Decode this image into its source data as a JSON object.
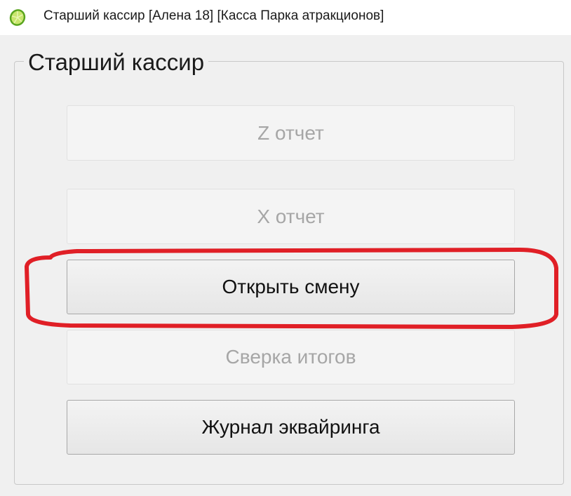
{
  "window": {
    "title": "Старший кассир [Алена 18] [Касса Парка атракционов]",
    "icon": "lime-slice-icon"
  },
  "group": {
    "legend": "Старший кассир"
  },
  "buttons": [
    {
      "label": "Z отчет",
      "enabled": false
    },
    {
      "label": "X отчет",
      "enabled": false
    },
    {
      "label": "Открыть смену",
      "enabled": true
    },
    {
      "label": "Сверка итогов",
      "enabled": false
    },
    {
      "label": "Журнал эквайринга",
      "enabled": true
    }
  ],
  "annotation": {
    "color": "#e01f26",
    "target": "Открыть смену"
  }
}
